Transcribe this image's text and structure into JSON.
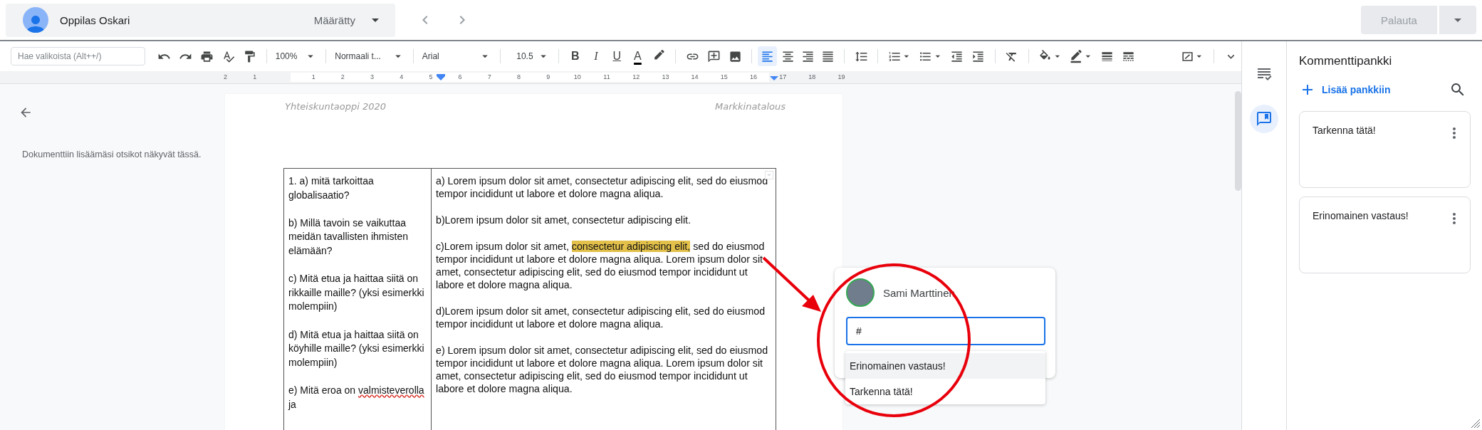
{
  "student_bar": {
    "name": "Oppilas Oskari",
    "status": "Määrätty"
  },
  "return_button": {
    "label": "Palauta",
    "disabled": true
  },
  "toolbar": {
    "search": {
      "placeholder": "Hae valikoista (Alt++/)"
    },
    "zoom": "100%",
    "style": "Normaali t...",
    "font": "Arial",
    "size": "10.5",
    "format_buttons": [
      "B",
      "I",
      "U",
      "A"
    ],
    "alignment": [
      {
        "selected": true
      },
      {
        "selected": false
      },
      {
        "selected": false
      },
      {
        "selected": false
      }
    ]
  },
  "ruler": {
    "left_marks": [
      "2",
      "1"
    ],
    "marks": [
      "1",
      "2",
      "3",
      "4",
      "5",
      "6",
      "7",
      "8",
      "9",
      "10",
      "11",
      "12",
      "13",
      "14",
      "15",
      "16",
      "17",
      "18",
      "19"
    ]
  },
  "outline": {
    "hint": "Dokumenttiin lisäämäsi otsikot näkyvät tässä."
  },
  "document": {
    "header_left": "Yhteiskuntaoppi 2020",
    "header_right": "Markkinatalous",
    "questions": [
      [
        {
          "text": "1. a) mitä tarkoittaa globalisaatio?",
          "kind": "plain"
        }
      ],
      [
        {
          "text": "b) Millä tavoin se vaikuttaa meidän tavallisten ihmisten elämään?",
          "kind": "plain"
        }
      ],
      [
        {
          "text": "c) Mitä etua ja haittaa siitä on rikkaille maille? (yksi esimerkki molempiin)",
          "kind": "plain"
        }
      ],
      [
        {
          "text": "d) Mitä etua ja haittaa siitä on köyhille maille? (yksi esimerkki molempiin)",
          "kind": "plain"
        }
      ],
      [
        {
          "text": "e) Mitä eroa on ",
          "kind": "plain"
        },
        {
          "text": "valmisteverolla",
          "kind": "misspelled"
        },
        {
          "text": " ja",
          "kind": "plain"
        }
      ]
    ],
    "answers": [
      [
        {
          "text": "a) Lorem ipsum dolor sit amet, consectetur adipiscing elit, sed do eiusmod tempor incididunt ut labore et dolore magna aliqua.",
          "kind": "plain"
        }
      ],
      [
        {
          "text": "b)Lorem ipsum dolor sit amet, consectetur adipiscing elit.",
          "kind": "plain"
        }
      ],
      [
        {
          "text": "c)Lorem ipsum dolor sit amet, ",
          "kind": "plain"
        },
        {
          "text": "consectetur adipiscing elit,",
          "kind": "highlighted"
        },
        {
          "text": " sed do eiusmod tempor incididunt ut labore et dolore magna aliqua. Lorem ipsum dolor sit amet, consectetur adipiscing elit, sed do eiusmod tempor incididunt ut labore et dolore magna aliqua.",
          "kind": "plain"
        }
      ],
      [
        {
          "text": "d)Lorem ipsum dolor sit amet, consectetur adipiscing elit, sed do eiusmod tempor incididunt ut labore et dolore magna aliqua.",
          "kind": "plain"
        }
      ],
      [
        {
          "text": "e) Lorem ipsum dolor sit amet, consectetur adipiscing elit, sed do eiusmod tempor incididunt ut labore et dolore magna aliqua. Lorem ipsum dolor sit amet, consectetur adipiscing elit, sed do eiusmod tempor incididunt ut labore et dolore magna aliqua.",
          "kind": "plain"
        }
      ]
    ]
  },
  "comment_popup": {
    "author": "Sami Marttinen",
    "value": "#",
    "suggestions": [
      {
        "text": "Erinomainen vastaus!",
        "selected": true
      },
      {
        "text": "Tarkenna tätä!",
        "selected": false
      }
    ]
  },
  "side_tabs": [
    {
      "selected": false
    },
    {
      "selected": true
    }
  ],
  "comment_bank": {
    "title": "Kommenttipankki",
    "add_label": "Lisää pankkiin",
    "comments": [
      "Tarkenna tätä!",
      "Erinomainen vastaus!"
    ]
  }
}
